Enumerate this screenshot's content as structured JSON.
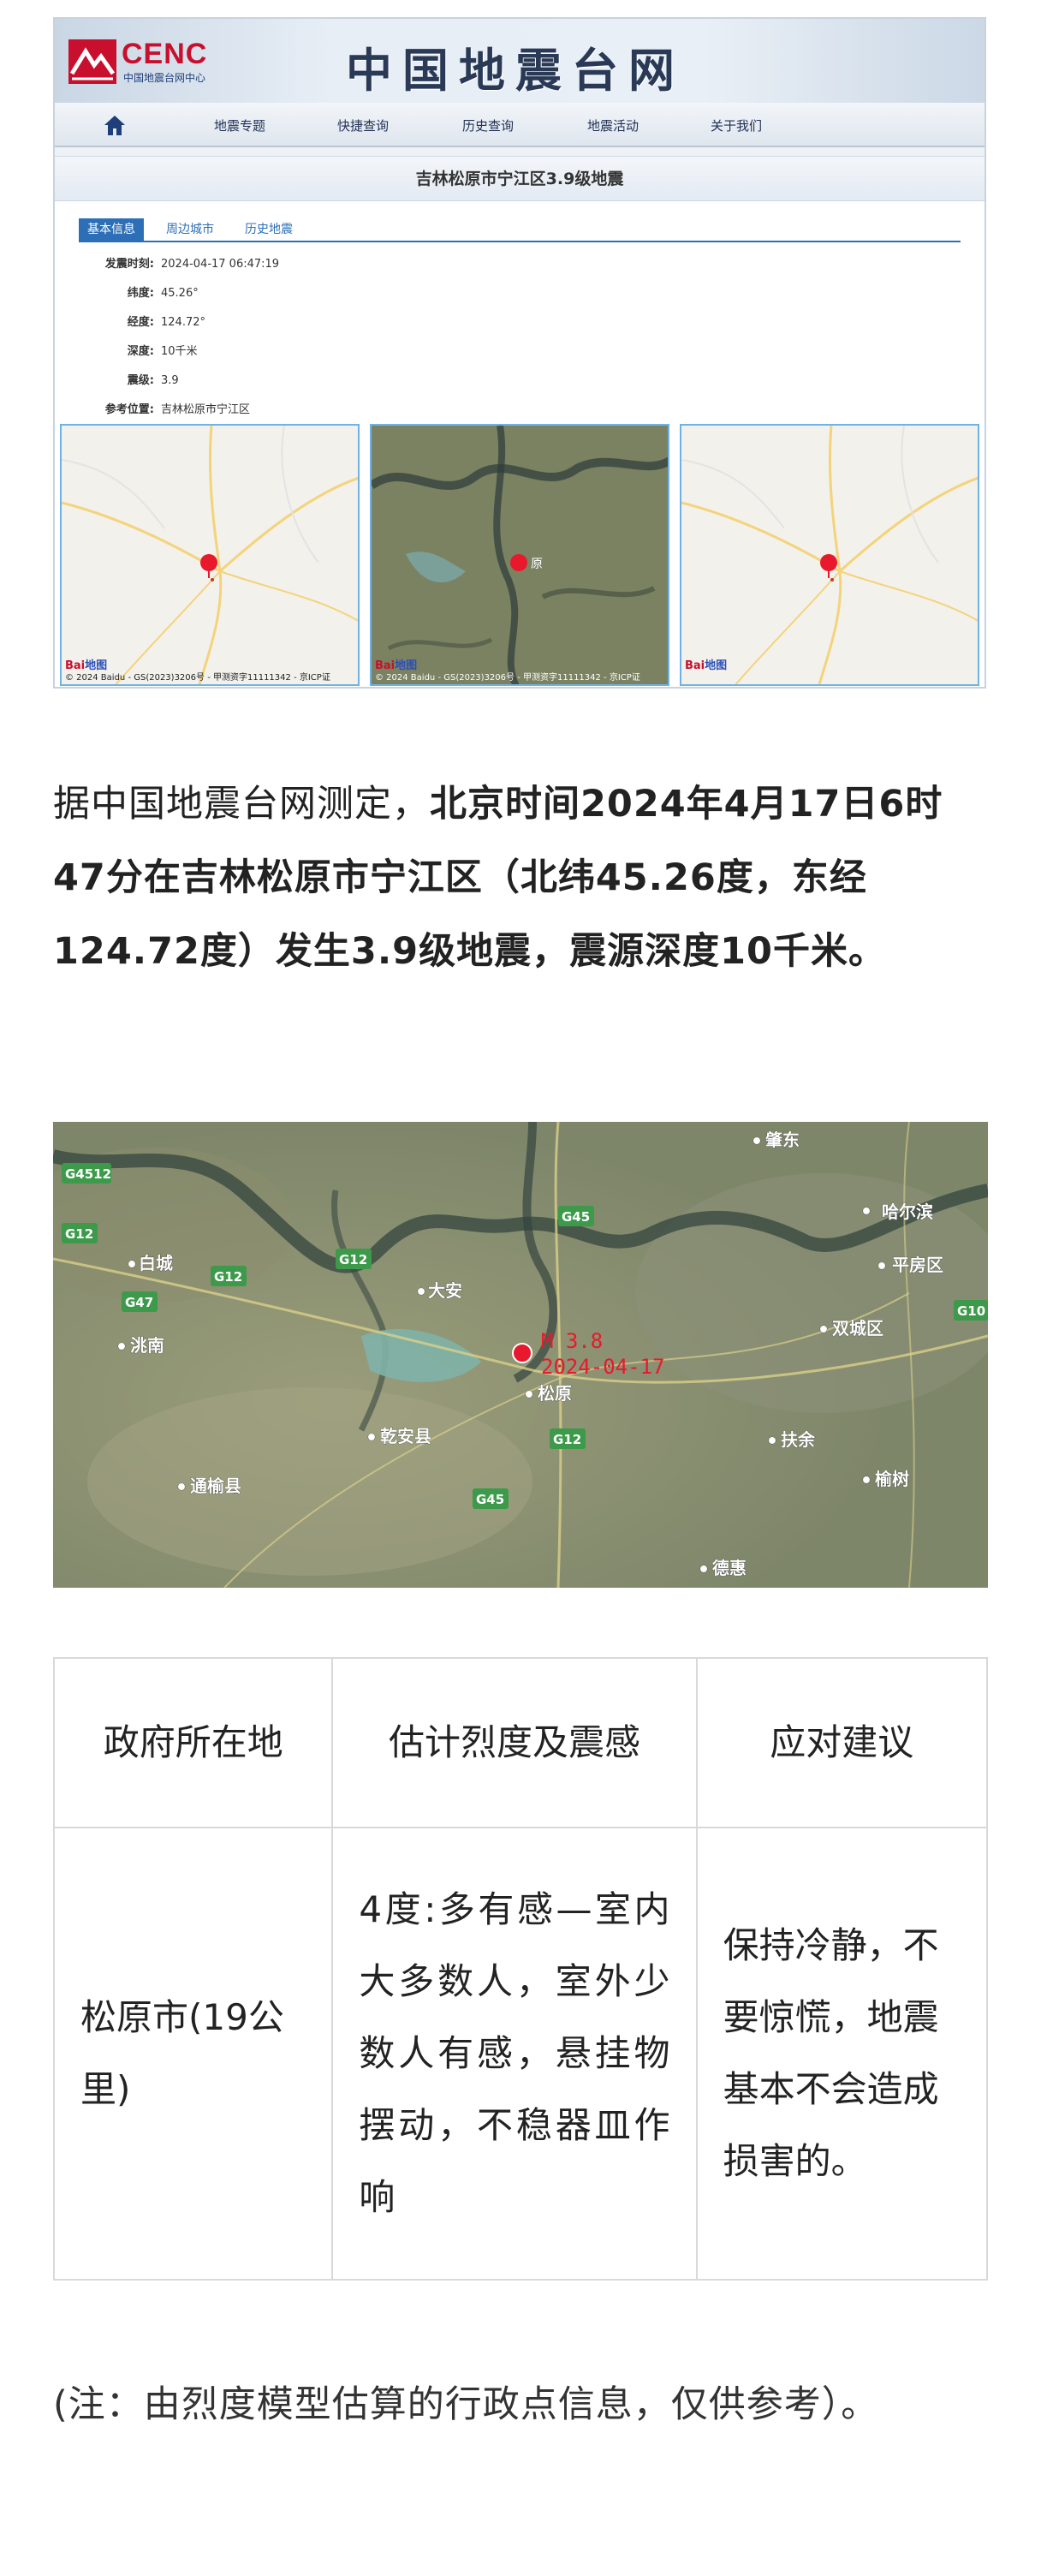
{
  "cenc": {
    "logo_text": "CENC",
    "logo_sub": "中国地震台网中心",
    "site_title": "中国地震台网",
    "nav": [
      "地震专题",
      "快捷查询",
      "历史查询",
      "地震活动",
      "关于我们"
    ],
    "panel_title": "吉林松原市宁江区3.9级地震",
    "tabs": [
      "基本信息",
      "周边城市",
      "历史地震"
    ],
    "info": [
      {
        "label": "发震时刻:",
        "value": "2024-04-17 06:47:19"
      },
      {
        "label": "纬度:",
        "value": "45.26°"
      },
      {
        "label": "经度:",
        "value": "124.72°"
      },
      {
        "label": "深度:",
        "value": "10千米"
      },
      {
        "label": "震级:",
        "value": "3.9"
      },
      {
        "label": "参考位置:",
        "value": "吉林松原市宁江区"
      }
    ],
    "map_copyright": "© 2024 Baidu - GS(2023)3206号 - 甲测资字11111342 - 京ICP证",
    "baidu_logo": "Bai",
    "baidu_logo_tail": "地图",
    "map_city_label": "原"
  },
  "article": {
    "intro": "据中国地震台网测定，",
    "bold": "北京时间2024年4月17日6时47分在吉林松原市宁江区（北纬45.26度，东经124.72度）发生3.9级地震，震源深度10千米。"
  },
  "bigmap": {
    "cities": [
      "肇东",
      "哈尔滨",
      "白城",
      "平房区",
      "大安",
      "洮南",
      "双城区",
      "松原",
      "乾安县",
      "扶余",
      "通榆县",
      "榆树",
      "德惠"
    ],
    "roads": [
      "G4512",
      "G12",
      "G45",
      "G47",
      "G12",
      "G12",
      "G45",
      "G12",
      "G10"
    ],
    "quake_label_mag": "M 3.8",
    "quake_label_date": "2024-04-17"
  },
  "table": {
    "headers": [
      "政府所在地",
      "估计烈度及震感",
      "应对建议"
    ],
    "row": [
      "松原市(19公里)",
      "4度:多有感—室内大多数人，室外少数人有感，悬挂物摆动，不稳器皿作响",
      "保持冷静，不要惊慌，地震基本不会造成损害的。"
    ]
  },
  "note": "(注：由烈度模型估算的行政点信息，仅供参考）。",
  "colors": {
    "accent": "#2c6fb7",
    "brand_red": "#c8102e",
    "marker": "#e8192c"
  }
}
